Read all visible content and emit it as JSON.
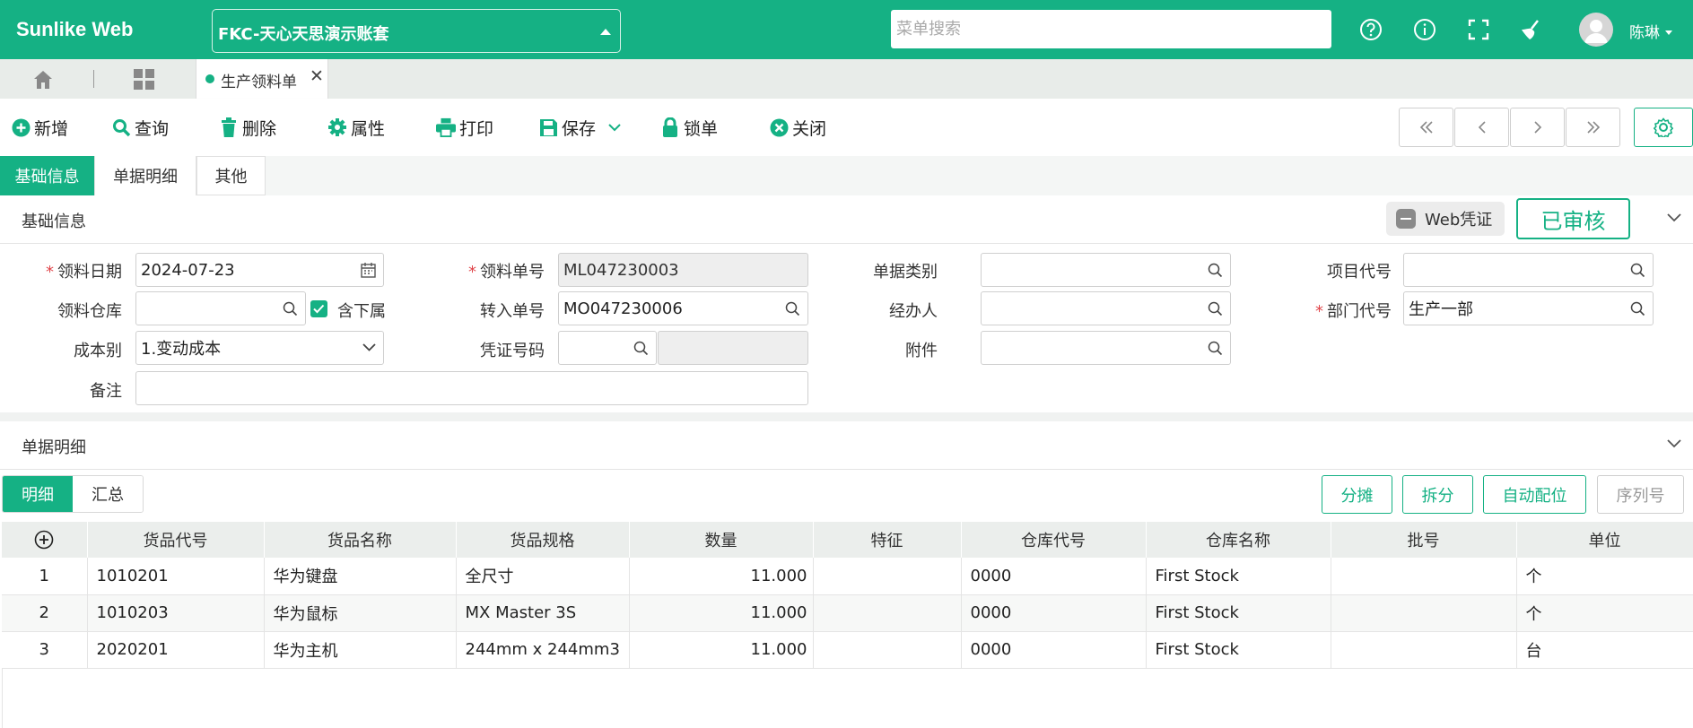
{
  "app": {
    "brand": "Sunlike Web"
  },
  "header": {
    "account": "FKC-天心天思演示账套",
    "search_placeholder": "菜单搜索",
    "user_name": "陈琳"
  },
  "tabs": {
    "open_tab": "生产领料单"
  },
  "toolbar": {
    "new": "新增",
    "query": "查询",
    "delete": "删除",
    "properties": "属性",
    "print": "打印",
    "save": "保存",
    "lock": "锁单",
    "close": "关闭"
  },
  "section_tabs": [
    "基础信息",
    "单据明细",
    "其他"
  ],
  "basic": {
    "title": "基础信息",
    "voucher_label": "Web凭证",
    "status": "已审核",
    "fields": {
      "pick_date": {
        "label": "领料日期",
        "value": "2024-07-23"
      },
      "pick_no": {
        "label": "领料单号",
        "value": "ML047230003"
      },
      "doc_type": {
        "label": "单据类别",
        "value": ""
      },
      "project_code": {
        "label": "项目代号",
        "value": ""
      },
      "warehouse": {
        "label": "领料仓库",
        "value": ""
      },
      "include_sub": "含下属",
      "transfer_no": {
        "label": "转入单号",
        "value": "MO047230006"
      },
      "handler": {
        "label": "经办人",
        "value": ""
      },
      "dept_code": {
        "label": "部门代号",
        "value": "生产一部"
      },
      "cost_type": {
        "label": "成本别",
        "value": "1.变动成本"
      },
      "voucher_no": {
        "label": "凭证号码",
        "value": ""
      },
      "attachment": {
        "label": "附件",
        "value": ""
      },
      "remark": {
        "label": "备注",
        "value": ""
      }
    }
  },
  "detail": {
    "title": "单据明细",
    "subtabs": [
      "明细",
      "汇总"
    ],
    "actions": [
      "分摊",
      "拆分",
      "自动配位",
      "序列号"
    ],
    "columns": [
      "货品代号",
      "货品名称",
      "货品规格",
      "数量",
      "特征",
      "仓库代号",
      "仓库名称",
      "批号",
      "单位"
    ],
    "rows": [
      {
        "no": "1",
        "code": "1010201",
        "name": "华为键盘",
        "spec": "全尺寸",
        "qty": "11.000",
        "feature": "",
        "wh_code": "0000",
        "wh_name": "First Stock",
        "batch": "",
        "unit": "个"
      },
      {
        "no": "2",
        "code": "1010203",
        "name": "华为鼠标",
        "spec": "MX Master 3S",
        "qty": "11.000",
        "feature": "",
        "wh_code": "0000",
        "wh_name": "First Stock",
        "batch": "",
        "unit": "个"
      },
      {
        "no": "3",
        "code": "2020201",
        "name": "华为主机",
        "spec": "244mm x 244mm3",
        "qty": "11.000",
        "feature": "",
        "wh_code": "0000",
        "wh_name": "First Stock",
        "batch": "",
        "unit": "台"
      }
    ]
  },
  "colors": {
    "accent": "#15b184",
    "required": "#e0464b"
  }
}
